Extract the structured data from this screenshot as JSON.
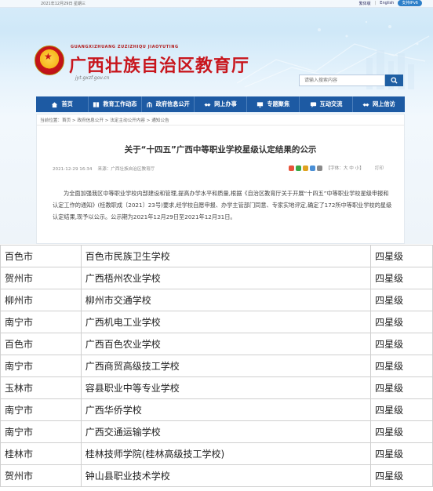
{
  "topbar": {
    "date": "2021年12月29日 星期三",
    "links": [
      "繁体版",
      "English"
    ],
    "ipv6_label": "支持IPv6"
  },
  "header": {
    "pinyin": "GUANGXIZHUANG ZUZIZHIQU JIAOYUTING",
    "title": "广西壮族自治区教育厅",
    "domain": "jyt.gxzf.gov.cn"
  },
  "search": {
    "placeholder": "请输入搜索内容"
  },
  "nav": {
    "items": [
      {
        "label": "首页",
        "icon": "home-icon"
      },
      {
        "label": "教育工作动态",
        "icon": "book-icon"
      },
      {
        "label": "政府信息公开",
        "icon": "building-icon"
      },
      {
        "label": "网上办事",
        "icon": "handshake-icon"
      },
      {
        "label": "专题聚焦",
        "icon": "monitor-icon"
      },
      {
        "label": "互动交流",
        "icon": "chat-icon"
      },
      {
        "label": "网上信访",
        "icon": "handshake-icon"
      }
    ]
  },
  "article": {
    "breadcrumb": "当前位置：首页 > 政府信息公开 > 法定主动公开内容 > 通知公告",
    "title": "关于“十四五”广西中等职业学校星级认定结果的公示",
    "date": "2021-12-29 16:34",
    "source": "来源：广西壮族自治区教育厅",
    "font_label": "【字体：大 中 小】",
    "print_label": "打印",
    "paragraph": "为全面加强我区中等职业学校内部建设和管理,提高办学水平和质量,根据《自治区教育厅关于开展“十四五”中等职业学校星级申报和认定工作的通知》(桂教职成〔2021〕23号)要求,经学校自愿申报、办学主管部门同意、专家实地评定,确定了172所中等职业学校的星级认定结果,现予以公示。公示期为2021年12月29日至2021年12月31日。"
  },
  "table": {
    "rows": [
      [
        "百色市",
        "百色市民族卫生学校",
        "四星级"
      ],
      [
        "贺州市",
        "广西梧州农业学校",
        "四星级"
      ],
      [
        "柳州市",
        "柳州市交通学校",
        "四星级"
      ],
      [
        "南宁市",
        "广西机电工业学校",
        "四星级"
      ],
      [
        "百色市",
        "广西百色农业学校",
        "四星级"
      ],
      [
        "南宁市",
        "广西商贸高级技工学校",
        "四星级"
      ],
      [
        "玉林市",
        "容县职业中等专业学校",
        "四星级"
      ],
      [
        "南宁市",
        "广西华侨学校",
        "四星级"
      ],
      [
        "南宁市",
        "广西交通运输学校",
        "四星级"
      ],
      [
        "桂林市",
        "桂林技师学院(桂林高级技工学校)",
        "四星级"
      ],
      [
        "贺州市",
        "钟山县职业技术学校",
        "四星级"
      ]
    ]
  },
  "colors": {
    "nav_bg": "#1d5aa3",
    "title_red": "#c8161d"
  }
}
